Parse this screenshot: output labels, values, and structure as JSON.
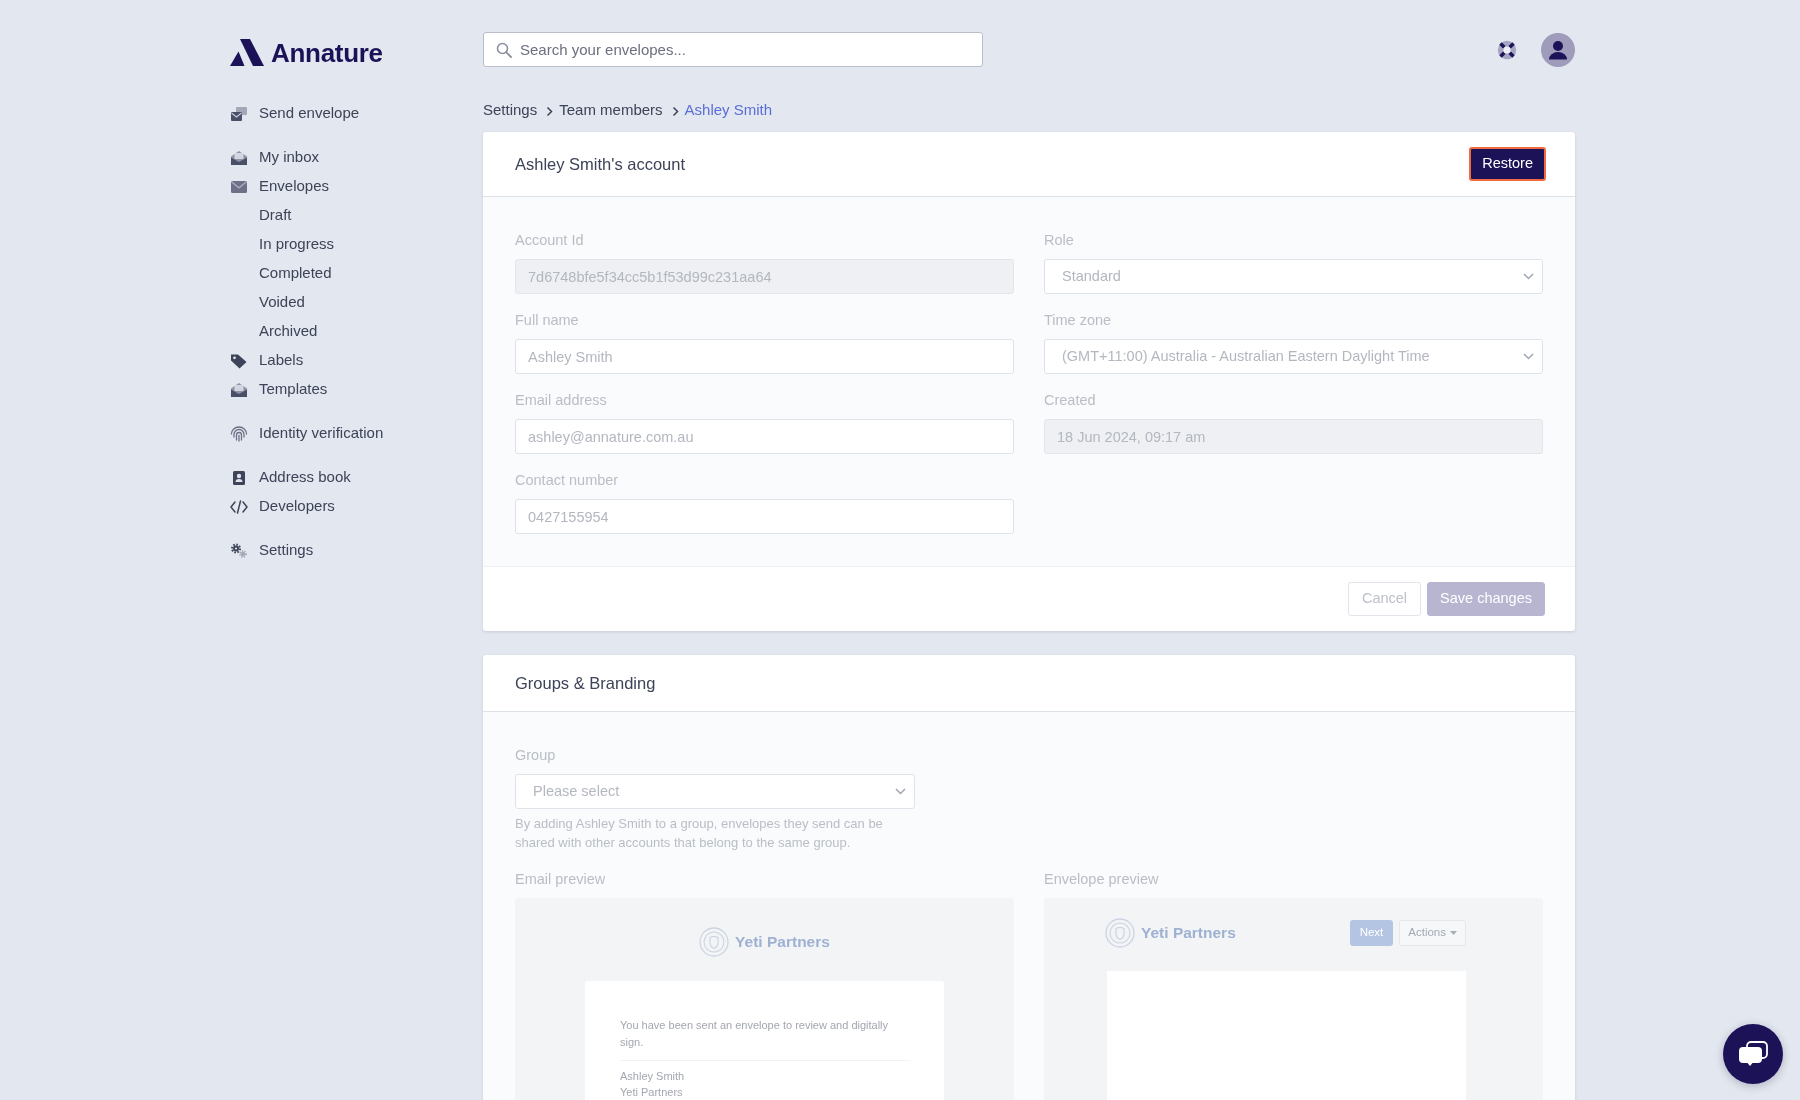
{
  "brand": {
    "name": "Annature"
  },
  "search": {
    "placeholder": "Search your envelopes..."
  },
  "sidebar": {
    "groups": [
      [
        {
          "label": "Send envelope"
        }
      ],
      [
        {
          "label": "My inbox"
        },
        {
          "label": "Envelopes",
          "children": [
            {
              "label": "Draft"
            },
            {
              "label": "In progress"
            },
            {
              "label": "Completed"
            },
            {
              "label": "Voided"
            },
            {
              "label": "Archived"
            }
          ]
        },
        {
          "label": "Labels"
        },
        {
          "label": "Templates"
        }
      ],
      [
        {
          "label": "Identity verification"
        }
      ],
      [
        {
          "label": "Address book"
        },
        {
          "label": "Developers"
        }
      ],
      [
        {
          "label": "Settings"
        }
      ]
    ]
  },
  "breadcrumb": [
    {
      "label": "Settings",
      "current": false
    },
    {
      "label": "Team members",
      "current": false
    },
    {
      "label": "Ashley Smith",
      "current": true
    }
  ],
  "account_card": {
    "title": "Ashley Smith's account",
    "restore_button": {
      "label": "Restore",
      "focused": true
    },
    "disabled": true,
    "fields": [
      {
        "label": "Account Id",
        "kind": "input",
        "value": "7d6748bfe5f34cc5b1f53d99c231aa64",
        "readonly": true
      },
      {
        "label": "Role",
        "kind": "select",
        "value": "Standard"
      },
      {
        "label": "Full name",
        "kind": "input",
        "value": "Ashley Smith",
        "readonly": false
      },
      {
        "label": "Time zone",
        "kind": "select",
        "value": "(GMT+11:00) Australia - Australian Eastern Daylight Time"
      },
      {
        "label": "Email address",
        "kind": "input",
        "value": "ashley@annature.com.au",
        "readonly": false
      },
      {
        "label": "Created",
        "kind": "input",
        "value": "18 Jun 2024, 09:17 am",
        "readonly": true
      },
      {
        "label": "Contact number",
        "kind": "input",
        "value": "0427155954",
        "readonly": false
      }
    ],
    "buttons": [
      {
        "label": "Cancel",
        "kind": "secondary",
        "disabled": true
      },
      {
        "label": "Save changes",
        "kind": "primary",
        "disabled": true
      }
    ]
  },
  "groups_card": {
    "title": "Groups & Branding",
    "disabled": true,
    "group": {
      "label": "Group",
      "value": "Please select",
      "help": "By adding Ashley Smith to a group, envelopes they send can be shared with other accounts that belong to the same group."
    },
    "email_preview": {
      "label": "Email preview",
      "brand": "Yeti Partners",
      "message": "You have been sent an envelope to review and digitally sign.",
      "sender_name": "Ashley Smith",
      "sender_company": "Yeti Partners"
    },
    "envelope_preview": {
      "label": "Envelope preview",
      "brand": "Yeti Partners",
      "buttons": [
        {
          "label": "Next",
          "kind": "primary"
        },
        {
          "label": "Actions",
          "kind": "dropdown"
        }
      ]
    }
  }
}
